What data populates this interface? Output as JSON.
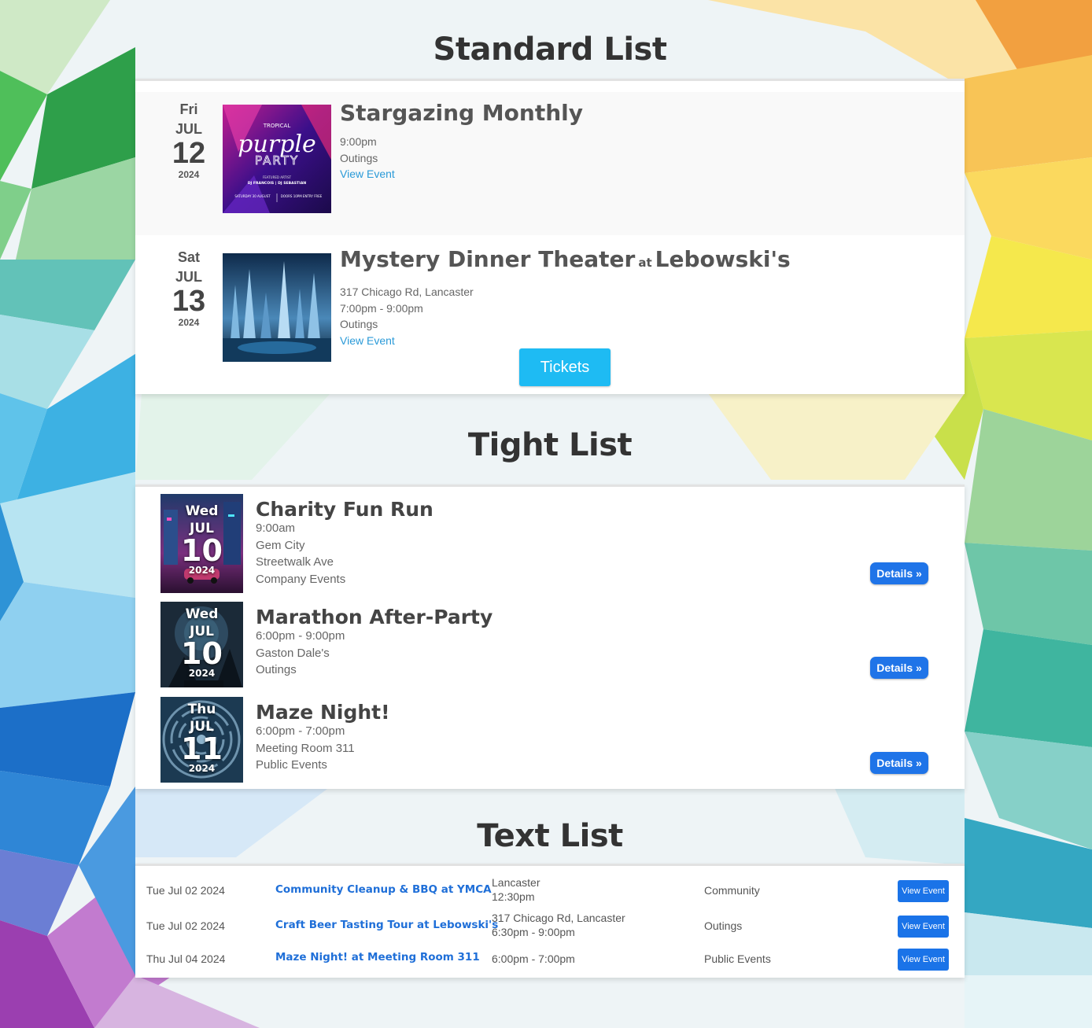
{
  "standard": {
    "heading": "Standard List",
    "events": [
      {
        "dow": "Fri",
        "month": "JUL",
        "day": "12",
        "year": "2024",
        "title": "Stargazing Monthly",
        "venue": "",
        "lines": [
          "9:00pm",
          "Outings"
        ],
        "link": "View Event",
        "image": {
          "pre": "TROPICAL",
          "script": "purple",
          "word": "PARTY",
          "featuring": "FEATURED ARTIST",
          "djs": "DJ FRANCOIS | DJ SEBASTIAN",
          "info_left": "SATURDAY 30 AUGUST",
          "info_right": "DOORS 10PM ENTRY FREE"
        }
      },
      {
        "dow": "Sat",
        "month": "JUL",
        "day": "13",
        "year": "2024",
        "title": "Mystery Dinner Theater",
        "at": "at",
        "venue": "Lebowski's",
        "lines": [
          "317 Chicago Rd, Lancaster",
          "7:00pm - 9:00pm",
          "Outings"
        ],
        "link": "View Event",
        "button": "Tickets"
      }
    ]
  },
  "tight": {
    "heading": "Tight List",
    "events": [
      {
        "dow": "Wed",
        "month": "JUL",
        "day": "10",
        "year": "2024",
        "title": "Charity Fun Run",
        "lines": [
          "9:00am",
          "Gem City",
          "Streetwalk Ave",
          "Company Events"
        ],
        "button": "Details »"
      },
      {
        "dow": "Wed",
        "month": "JUL",
        "day": "10",
        "year": "2024",
        "title": "Marathon After-Party",
        "lines": [
          "6:00pm - 9:00pm",
          "Gaston Dale's",
          "Outings"
        ],
        "button": "Details »"
      },
      {
        "dow": "Thu",
        "month": "JUL",
        "day": "11",
        "year": "2024",
        "title": "Maze Night!",
        "lines": [
          "6:00pm - 7:00pm",
          "Meeting Room 311",
          "Public Events"
        ],
        "button": "Details »"
      }
    ]
  },
  "text": {
    "heading": "Text List",
    "events": [
      {
        "date": "Tue Jul 02 2024",
        "title": "Community Cleanup & BBQ at YMCA",
        "where": [
          "Lancaster",
          "12:30pm"
        ],
        "category": "Community",
        "button": "View Event"
      },
      {
        "date": "Tue Jul 02 2024",
        "title": "Craft Beer Tasting Tour at Lebowski's",
        "where": [
          "317 Chicago Rd, Lancaster",
          "6:30pm - 9:00pm"
        ],
        "category": "Outings",
        "button": "View Event"
      },
      {
        "date": "Thu Jul 04 2024",
        "title": "Maze Night! at Meeting Room 311",
        "where": [
          "6:00pm - 7:00pm"
        ],
        "category": "Public Events",
        "button": "View Event"
      }
    ]
  }
}
